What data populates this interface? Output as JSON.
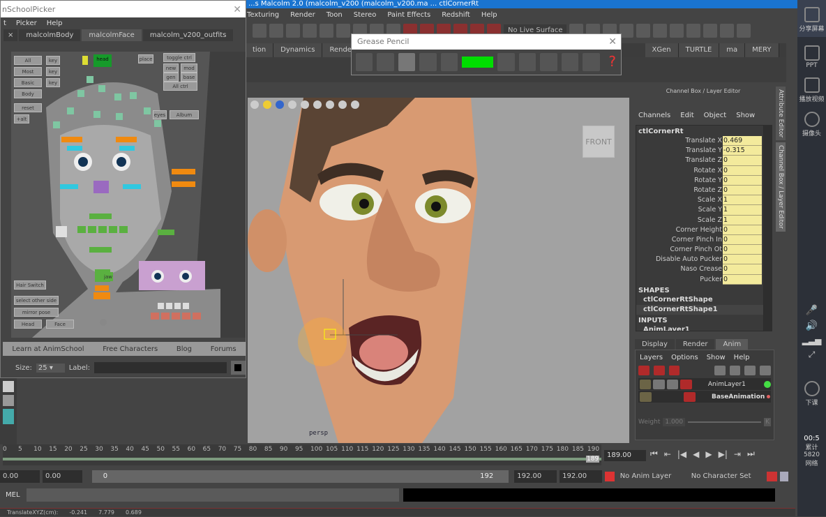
{
  "maya": {
    "title": "...s Malcolm 2.0 (malcolm_v200 (malcolm_v200.ma ... ctlCornerRt",
    "menu": [
      "Texturing",
      "Render",
      "Toon",
      "Stereo",
      "Paint Effects",
      "Redshift",
      "Help"
    ],
    "live_surface": "No Live Surface",
    "shelf_tabs": [
      "tion",
      "Dynamics",
      "Rendering",
      "XGen",
      "TURTLE",
      "ma",
      "MERY"
    ]
  },
  "grease_pencil": {
    "title": "Grease Pencil",
    "color": "#00dd00"
  },
  "viewport": {
    "camera_cube": "FRONT",
    "camera": "persp"
  },
  "channel_box": {
    "title": "Channel Box / Layer Editor",
    "menu": [
      "Channels",
      "Edit",
      "Object",
      "Show"
    ],
    "node": "ctlCornerRt",
    "channels": [
      {
        "name": "Translate X",
        "value": "0.469"
      },
      {
        "name": "Translate Y",
        "value": "-0.315"
      },
      {
        "name": "Translate Z",
        "value": "0"
      },
      {
        "name": "Rotate X",
        "value": "0"
      },
      {
        "name": "Rotate Y",
        "value": "0"
      },
      {
        "name": "Rotate Z",
        "value": "0"
      },
      {
        "name": "Scale X",
        "value": "1"
      },
      {
        "name": "Scale Y",
        "value": "1"
      },
      {
        "name": "Scale Z",
        "value": "1"
      },
      {
        "name": "Corner Height",
        "value": "0"
      },
      {
        "name": "Corner Pinch In",
        "value": "0"
      },
      {
        "name": "Corner Pinch Ot",
        "value": "0"
      },
      {
        "name": "Disable Auto Pucker",
        "value": "0"
      },
      {
        "name": "Naso Crease",
        "value": "0"
      },
      {
        "name": "Pucker",
        "value": "0"
      }
    ],
    "shapes_header": "SHAPES",
    "shapes": [
      "ctlCornerRtShape",
      "ctlCornerRtShape1"
    ],
    "inputs_header": "INPUTS",
    "inputs": [
      "AnimLayer1"
    ]
  },
  "vertical_tabs": [
    "Attribute Editor",
    "Channel Box / Layer Editor"
  ],
  "layer_editor": {
    "tabs": [
      "Display",
      "Render",
      "Anim"
    ],
    "active_tab": "Anim",
    "menu": [
      "Layers",
      "Options",
      "Show",
      "Help"
    ],
    "layers": [
      {
        "name": "AnimLayer1",
        "status_color": "#44dd44"
      },
      {
        "name": "BaseAnimation",
        "status_color": "#e06060"
      }
    ],
    "weight_label": "Weight",
    "weight_value": "1.000",
    "key_label": "K"
  },
  "timeline": {
    "ticks": [
      "0",
      "5",
      "10",
      "15",
      "20",
      "25",
      "30",
      "35",
      "40",
      "45",
      "50",
      "55",
      "60",
      "65",
      "70",
      "75",
      "80",
      "85",
      "90",
      "95",
      "100",
      "105",
      "110",
      "115",
      "120",
      "125",
      "130",
      "135",
      "140",
      "145",
      "150",
      "155",
      "160",
      "165",
      "170",
      "175",
      "180",
      "185",
      "190"
    ],
    "current_marker": "189",
    "current_frame": "189.00"
  },
  "range": {
    "start": "0.00",
    "anim_start": "0.00",
    "slider_start": "0",
    "slider_end": "192",
    "end": "192.00",
    "anim_end": "192.00",
    "anim_layer": "No Anim Layer",
    "character_set": "No Character Set"
  },
  "mel": {
    "label": "MEL"
  },
  "help_line": {
    "label": "TranslateXYZ(cm):",
    "x": "-0.241",
    "y": "7.779",
    "z": "0.689"
  },
  "side_panel": {
    "items": [
      "分享屏幕",
      "PPT",
      "播放视频",
      "摄像头",
      "下课"
    ],
    "time": "00:5",
    "stats": [
      "累计",
      "5820",
      "网络"
    ]
  },
  "picker": {
    "title": "nSchoolPicker",
    "menu": [
      "t",
      "Picker",
      "Help"
    ],
    "tabs": [
      "malcolmBody",
      "malcolmFace",
      "malcolm_v200_outfits"
    ],
    "active_tab": "malcolmFace",
    "buttons": {
      "all": "All",
      "key1": "key",
      "most": "Most",
      "key2": "key",
      "base": "Basic",
      "key3": "key",
      "body": "Body",
      "reset": "reset",
      "alt": "+alt",
      "head": "head",
      "place": "place",
      "toggle": "toggle ctrl",
      "new": "new",
      "mod": "mod",
      "gen": "gen",
      "base2": "base",
      "all2": "All ctrl",
      "eyes": "eyes",
      "album": "Album",
      "jaw": "jaw",
      "hair": "Hair Switch",
      "select_other": "select other side",
      "mirror": "mirror pose",
      "head2": "Head",
      "face": "Face"
    },
    "links": [
      "Learn at AnimSchool",
      "Free Characters",
      "Blog",
      "Forums"
    ],
    "size_label": "Size:",
    "size_value": "25",
    "label_label": "Label:"
  }
}
